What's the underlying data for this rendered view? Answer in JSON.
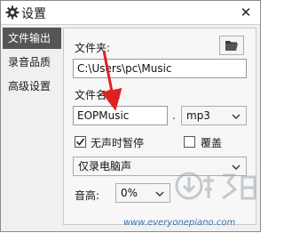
{
  "window": {
    "title": "设置",
    "close_symbol": "✕",
    "icons": {
      "title": "gear-icon",
      "close": "close-icon"
    }
  },
  "sidebar": {
    "items": [
      {
        "label": "文件输出",
        "active": true
      },
      {
        "label": "录音品质",
        "active": false
      },
      {
        "label": "高级设置",
        "active": false
      }
    ]
  },
  "file_output": {
    "folder_label": "文件夹:",
    "folder_value": "C:\\Users\\pc\\Music",
    "folder_button_icon": "folder-icon",
    "filename_label": "文件名称:",
    "filename_value": "EOPMusic",
    "dot": ".",
    "extension_selected": "mp3",
    "silence_pause_label": "无声时暂停",
    "silence_pause_checked": true,
    "overwrite_label": "覆盖",
    "overwrite_checked": false,
    "source_selected": "仅录电脑声",
    "volume_label": "音高:",
    "volume_selected": "0%"
  },
  "watermark": {
    "url": "www.everyonepiano.com",
    "logo_icon": "download-site-logo-icon"
  },
  "colors": {
    "sidebar_active_bg": "#555555",
    "annotation_arrow": "#e02020",
    "watermark": "#3a6fb8"
  }
}
